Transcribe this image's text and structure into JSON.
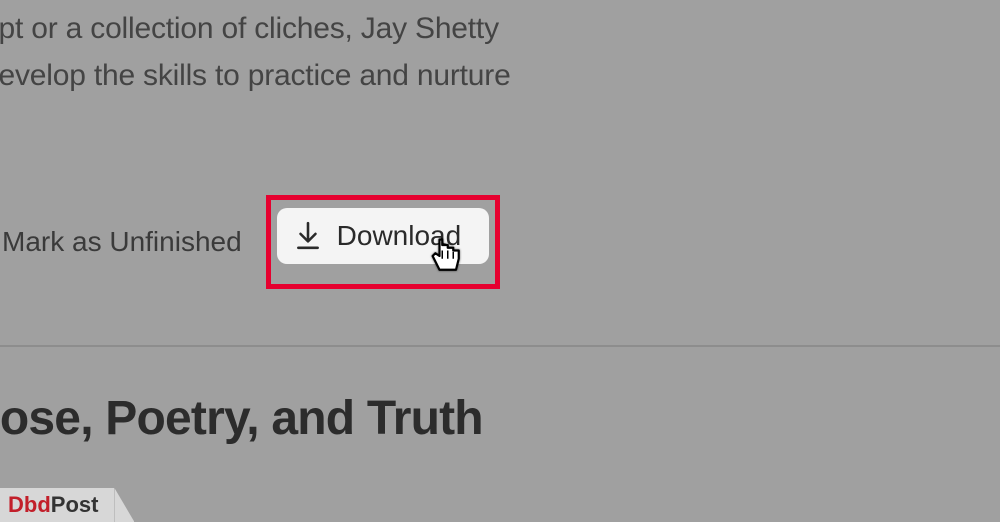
{
  "description": {
    "line1": "ept or a collection of cliches, Jay Shetty",
    "line2": "develop the skills to practice and nurture"
  },
  "actions": {
    "mark_unfinished_label": "Mark as Unfinished",
    "download_label": "Download"
  },
  "chapter": {
    "title": "rose, Poetry, and Truth"
  },
  "watermark": {
    "part1": "Dbd",
    "part2": "Post"
  },
  "highlight_color": "#e6002f"
}
